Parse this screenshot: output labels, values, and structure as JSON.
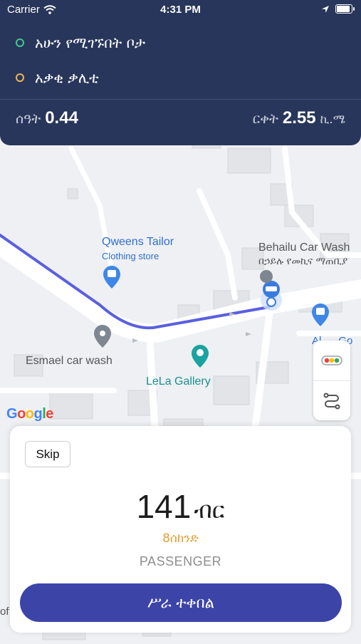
{
  "status_bar": {
    "carrier": "Carrier",
    "time": "4:31 PM"
  },
  "header": {
    "current_location": "አሁን የሚገኙበት ቦታ",
    "destination": "አቃቂ ቃሊቲ",
    "time_label": "ሰዓት",
    "time_value": "0.44",
    "distance_label": "ርቀት",
    "distance_value": "2.55",
    "distance_unit": "ኪ.ሜ"
  },
  "map": {
    "places": {
      "qweens_tailor": "Qweens Tailor",
      "qweens_tailor_sub": "Clothing store",
      "behailu_car_wash": "Behailu Car Wash",
      "behailu_car_wash_sub": "በኃይሉ የመኪና ማጠቢያ",
      "esmael_car_wash": "Esmael car wash",
      "lela_gallery": "LeLa Gallery",
      "partial_right": "Al",
      "partial_right_2": "Go",
      "partial_left": "of"
    },
    "attribution": "Google"
  },
  "offer": {
    "skip_label": "Skip",
    "price": "141",
    "currency": "ብር",
    "countdown": "8ሰከንድ",
    "role": "PASSENGER",
    "accept_label": "ሥራ ተቀበል"
  },
  "colors": {
    "header_bg": "#28365b",
    "accept_button": "#3d44a8",
    "route_line": "#5a5fe0",
    "countdown_text": "#e4a13a"
  }
}
